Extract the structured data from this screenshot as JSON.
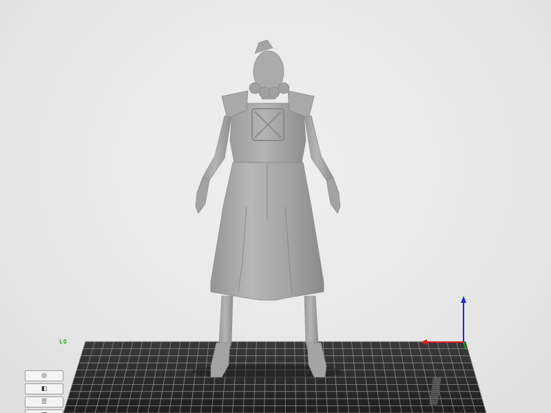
{
  "viewport": {
    "background_color": "#e9e9e9",
    "model_color": "#a8a8a8",
    "bed_color": "#2b2b2b",
    "grid_color": "#8c8c8c"
  },
  "build_plate": {
    "label": "LO",
    "label_color": "#1fa31f"
  },
  "axes": {
    "x_color": "#e02020",
    "y_color": "#1fa31f",
    "z_color": "#1a2ad8"
  },
  "toolbar": {
    "items": [
      {
        "name": "view-3d-icon",
        "glyph": "◎"
      },
      {
        "name": "view-front-icon",
        "glyph": "◧"
      },
      {
        "name": "view-layers-icon",
        "glyph": "☰"
      },
      {
        "name": "view-side-icon",
        "glyph": "◨"
      },
      {
        "name": "view-reset-icon",
        "glyph": "⟲"
      }
    ]
  }
}
